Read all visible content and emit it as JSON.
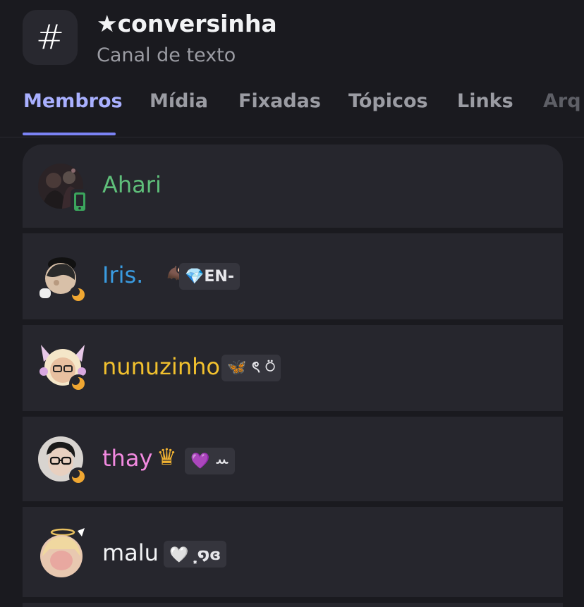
{
  "channel": {
    "icon": "#",
    "icon_name": "hashtag-icon",
    "title": "★conversinha",
    "subtitle": "Canal de texto"
  },
  "tabs": [
    {
      "label": "Membros",
      "active": true
    },
    {
      "label": "Mídia",
      "active": false
    },
    {
      "label": "Fixadas",
      "active": false
    },
    {
      "label": "Tópicos",
      "active": false
    },
    {
      "label": "Links",
      "active": false
    },
    {
      "label": "Arq",
      "active": false
    }
  ],
  "members": [
    {
      "name": "Ahari",
      "name_color": "#5fbf7a",
      "status": "mobile-online",
      "decoration": "",
      "tag": ""
    },
    {
      "name": "Iris.",
      "name_color": "#3a9be0",
      "status": "idle",
      "decoration": "🦇",
      "tag": "💎EN-"
    },
    {
      "name": "nunuzinho",
      "name_color": "#f2c12e",
      "status": "idle",
      "decoration": "",
      "tag": "🦋 ৎ ⍥"
    },
    {
      "name": "thay",
      "name_color": "#f28ae0",
      "status": "idle",
      "decoration": "♛",
      "tag": "💜 ꕀ"
    },
    {
      "name": "malu",
      "name_color": "#f2f3f5",
      "status": "",
      "decoration": "",
      "tag": "🤍 ⸼໑ɞ"
    }
  ],
  "colors": {
    "accent": "#7b83f5",
    "online": "#3ba55d",
    "idle": "#f0a732",
    "background": "#1a1a1f",
    "card": "#26262d"
  }
}
